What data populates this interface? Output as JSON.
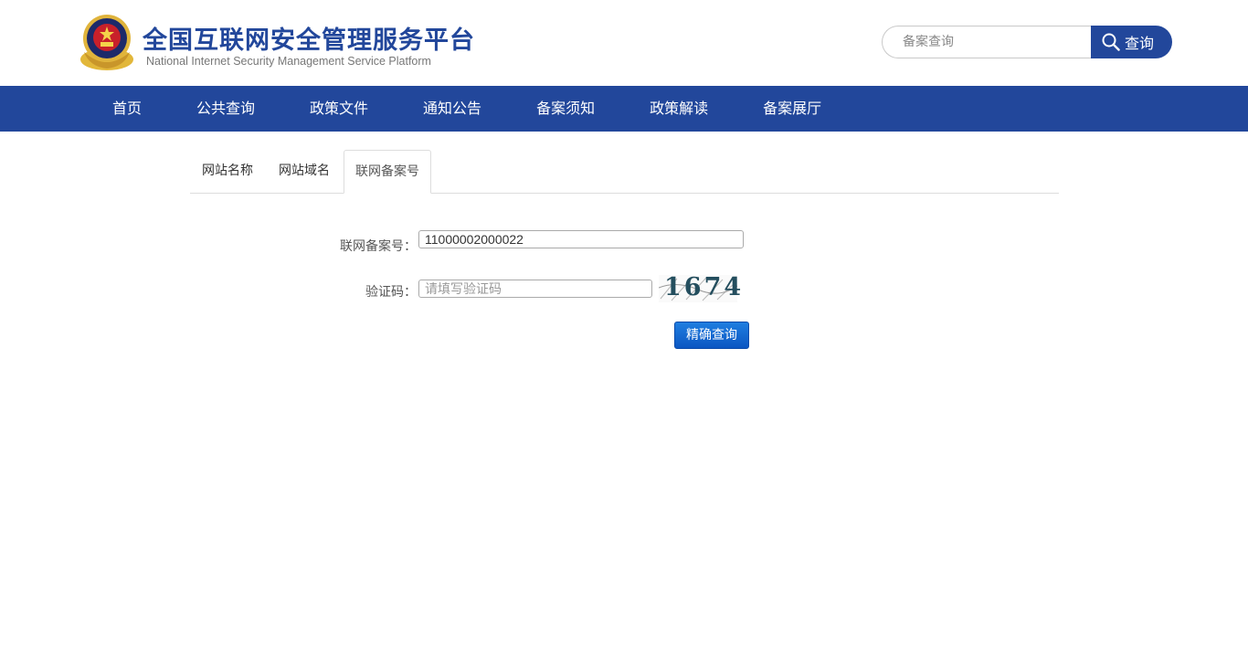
{
  "header": {
    "title": "全国互联网安全管理服务平台",
    "subtitle": "National Internet Security Management Service Platform",
    "logo_icon": "police-emblem-icon"
  },
  "search": {
    "placeholder": "备案查询",
    "button_label": "查询",
    "icon": "search-icon"
  },
  "nav": {
    "items": [
      "首页",
      "公共查询",
      "政策文件",
      "通知公告",
      "备案须知",
      "政策解读",
      "备案展厅"
    ]
  },
  "tabs": {
    "items": [
      "网站名称",
      "网站域名",
      "联网备案号"
    ],
    "active": "联网备案号"
  },
  "form": {
    "record_label": "联网备案号：",
    "record_value": "11000002000022",
    "captcha_label": "验证码：",
    "captcha_placeholder": "请填写验证码",
    "captcha_text": "1674",
    "submit_label": "精确查询"
  },
  "colors": {
    "brand_blue": "#22479b",
    "button_blue": "#0b56c2"
  }
}
